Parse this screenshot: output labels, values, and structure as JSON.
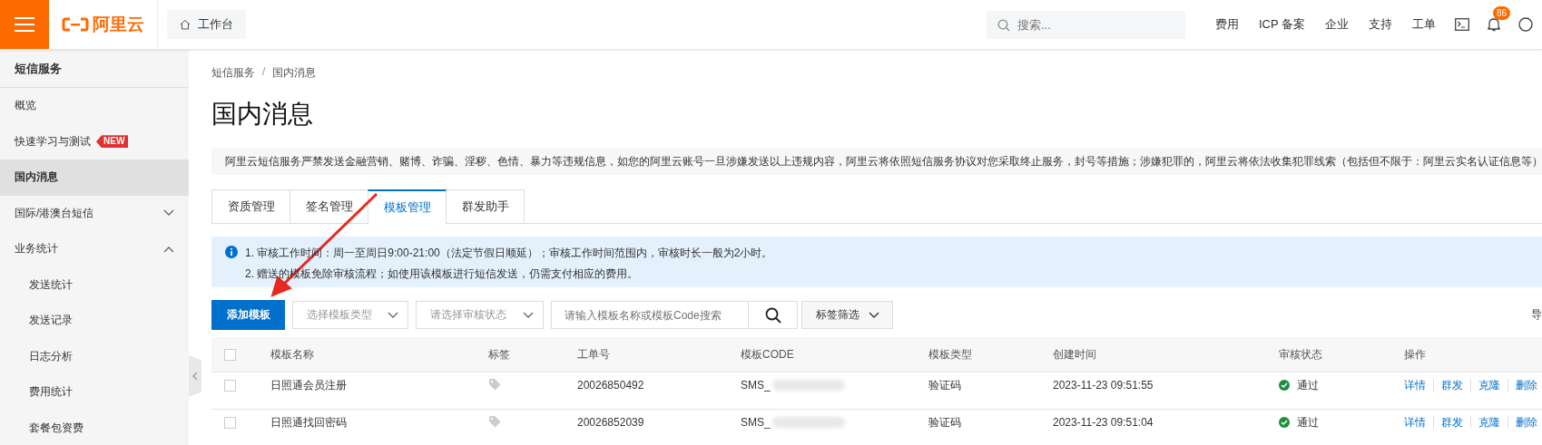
{
  "topbar": {
    "brand": "阿里云",
    "workbench": "工作台",
    "search": {
      "placeholder": "搜索..."
    },
    "nav": [
      "费用",
      "ICP 备案",
      "企业",
      "支持",
      "工单"
    ],
    "notifications_badge": "86"
  },
  "sidebar": {
    "title": "短信服务",
    "items": [
      {
        "label": "概览",
        "selected": false
      },
      {
        "label": "快速学习与测试",
        "selected": false,
        "badge": "NEW"
      },
      {
        "label": "国内消息",
        "selected": true
      },
      {
        "label": "国际/港澳台短信",
        "selected": false,
        "expanded": false
      },
      {
        "label": "业务统计",
        "selected": false,
        "expanded": true,
        "children": [
          {
            "label": "发送统计",
            "selected": false
          },
          {
            "label": "发送记录",
            "selected": false
          },
          {
            "label": "日志分析",
            "selected": false
          },
          {
            "label": "费用统计",
            "selected": false
          },
          {
            "label": "套餐包资费",
            "selected": false
          }
        ]
      }
    ]
  },
  "breadcrumb": {
    "items": [
      "短信服务",
      "国内消息"
    ],
    "separator": "/"
  },
  "page_title": "国内消息",
  "notice": "阿里云短信服务严禁发送金融营销、赌博、诈骗、淫秽、色情、暴力等违规信息，如您的阿里云账号一旦涉嫌发送以上违规内容，阿里云将依照短信服务协议对您采取终止服务，封号等措施；涉嫌犯罪的，阿里云将依法收集犯罪线索（包括但不限于：阿里云实名认证信息等）",
  "tabs": [
    {
      "label": "资质管理",
      "selected": false
    },
    {
      "label": "签名管理",
      "selected": false
    },
    {
      "label": "模板管理",
      "selected": true
    },
    {
      "label": "群发助手",
      "selected": false
    }
  ],
  "info_lines": [
    "1. 审核工作时间：周一至周日9:00-21:00（法定节假日顺延）；审核工作时间范围内，审核时长一般为2小时。",
    "2. 赠送的模板免除审核流程；如使用该模板进行短信发送，仍需支付相应的费用。"
  ],
  "toolbar": {
    "add_button": "添加模板",
    "type_select": {
      "placeholder": "选择模板类型"
    },
    "status_select": {
      "placeholder": "请选择审核状态"
    },
    "search": {
      "placeholder": "请输入模板名称或模板Code搜索"
    },
    "tag_filter": "标签筛选",
    "export_button": "导"
  },
  "table": {
    "select_all_checked": false,
    "columns": [
      "模板名称",
      "标签",
      "工单号",
      "模板CODE",
      "模板类型",
      "创建时间",
      "审核状态",
      "操作"
    ],
    "rows": [
      {
        "checked": false,
        "name": "日照通会员注册",
        "ticket": "20026850492",
        "code": "SMS_",
        "type": "验证码",
        "created": "2023-11-23 09:51:55",
        "status": "通过",
        "actions": [
          "详情",
          "群发",
          "克隆",
          "删除"
        ]
      },
      {
        "checked": false,
        "name": "日照通找回密码",
        "ticket": "20026852039",
        "code": "SMS_",
        "type": "验证码",
        "created": "2023-11-23 09:51:04",
        "status": "通过",
        "actions": [
          "详情",
          "群发",
          "克隆",
          "删除"
        ]
      }
    ]
  }
}
